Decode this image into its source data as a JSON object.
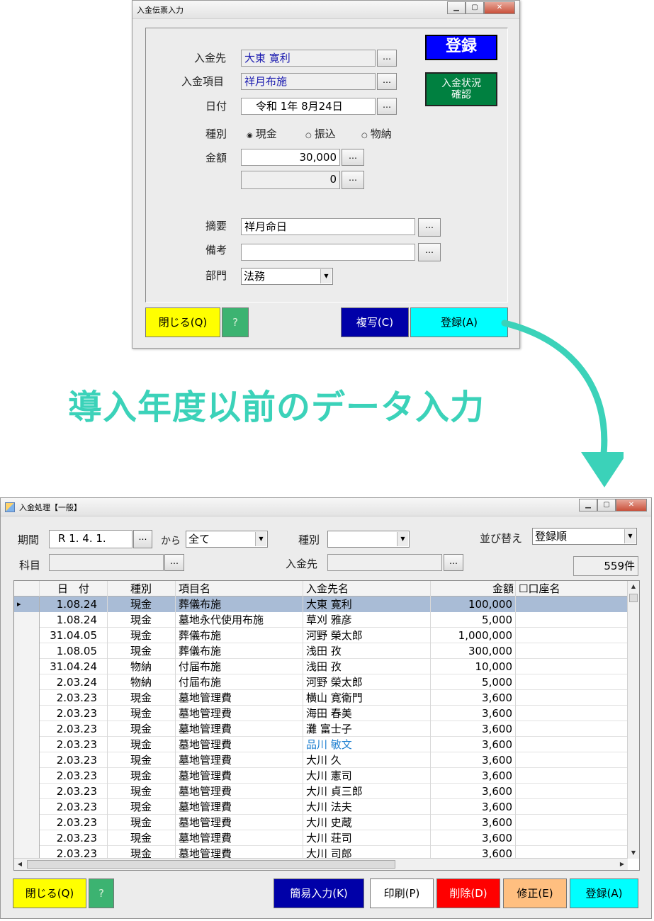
{
  "entry_dialog": {
    "title": "入金伝票入力",
    "register_top_label": "登録",
    "status_button_label": "入金状況\n確認",
    "labels": {
      "payer": "入金先",
      "item": "入金項目",
      "date": "日付",
      "kind": "種別",
      "amount": "金額",
      "summary": "摘要",
      "remarks": "備考",
      "department": "部門"
    },
    "values": {
      "payer": "大東 寛利",
      "item": "祥月布施",
      "date": "令和 1年 8月24日",
      "amount": "30,000",
      "amount2": "0",
      "summary": "祥月命日",
      "remarks": "",
      "department": "法務"
    },
    "kind_options": [
      "現金",
      "振込",
      "物納"
    ],
    "kind_selected": "現金",
    "dots_label": "…",
    "footer": {
      "close": "閉じる(Q)",
      "help": "?",
      "copy": "複写(C)",
      "register": "登録(A)"
    }
  },
  "banner_text": "導入年度以前のデータ入力",
  "list_window": {
    "title": "入金処理【一般】",
    "filters": {
      "period_label": "期間",
      "period_value": "R 1. 4. 1.",
      "from_label": "から",
      "to_value": "全て",
      "kind_label": "種別",
      "kind_value": "",
      "sort_label": "並び替え",
      "sort_value": "登録順",
      "subject_label": "科目",
      "subject_value": "",
      "payer_label": "入金先",
      "payer_value": "",
      "count": "559件"
    },
    "columns": [
      "日　付",
      "種別",
      "項目名",
      "入金先名",
      "金額",
      "口座名"
    ],
    "rows": [
      {
        "date": "1.08.24",
        "kind": "現金",
        "item": "葬儀布施",
        "payer": "大東 寛利",
        "amount": "100,000",
        "account": ""
      },
      {
        "date": "1.08.24",
        "kind": "現金",
        "item": "墓地永代使用布施",
        "payer": "草刈 雅彦",
        "amount": "5,000",
        "account": ""
      },
      {
        "date": "31.04.05",
        "kind": "現金",
        "item": "葬儀布施",
        "payer": "河野 榮太郎",
        "amount": "1,000,000",
        "account": ""
      },
      {
        "date": "1.08.05",
        "kind": "現金",
        "item": "葬儀布施",
        "payer": "浅田 孜",
        "amount": "300,000",
        "account": ""
      },
      {
        "date": "31.04.24",
        "kind": "物納",
        "item": "付届布施",
        "payer": "浅田 孜",
        "amount": "10,000",
        "account": ""
      },
      {
        "date": "2.03.24",
        "kind": "物納",
        "item": "付届布施",
        "payer": "河野 榮太郎",
        "amount": "5,000",
        "account": ""
      },
      {
        "date": "2.03.23",
        "kind": "現金",
        "item": "墓地管理費",
        "payer": "横山 寛衛門",
        "amount": "3,600",
        "account": ""
      },
      {
        "date": "2.03.23",
        "kind": "現金",
        "item": "墓地管理費",
        "payer": "海田 春美",
        "amount": "3,600",
        "account": ""
      },
      {
        "date": "2.03.23",
        "kind": "現金",
        "item": "墓地管理費",
        "payer": "灘 富士子",
        "amount": "3,600",
        "account": ""
      },
      {
        "date": "2.03.23",
        "kind": "現金",
        "item": "墓地管理費",
        "payer": "品川 敏文",
        "amount": "3,600",
        "account": ""
      },
      {
        "date": "2.03.23",
        "kind": "現金",
        "item": "墓地管理費",
        "payer": "大川 久",
        "amount": "3,600",
        "account": ""
      },
      {
        "date": "2.03.23",
        "kind": "現金",
        "item": "墓地管理費",
        "payer": "大川 憲司",
        "amount": "3,600",
        "account": ""
      },
      {
        "date": "2.03.23",
        "kind": "現金",
        "item": "墓地管理費",
        "payer": "大川 貞三郎",
        "amount": "3,600",
        "account": ""
      },
      {
        "date": "2.03.23",
        "kind": "現金",
        "item": "墓地管理費",
        "payer": "大川 法夫",
        "amount": "3,600",
        "account": ""
      },
      {
        "date": "2.03.23",
        "kind": "現金",
        "item": "墓地管理費",
        "payer": "大川 史蔵",
        "amount": "3,600",
        "account": ""
      },
      {
        "date": "2.03.23",
        "kind": "現金",
        "item": "墓地管理費",
        "payer": "大川 荘司",
        "amount": "3,600",
        "account": ""
      },
      {
        "date": "2.03.23",
        "kind": "現金",
        "item": "墓地管理費",
        "payer": "大川 司郎",
        "amount": "3,600",
        "account": ""
      }
    ],
    "footer": {
      "close": "閉じる(Q)",
      "help": "?",
      "quick": "簡易入力(K)",
      "print": "印刷(P)",
      "delete": "削除(D)",
      "edit": "修正(E)",
      "register": "登録(A)"
    }
  },
  "colors": {
    "register_blue": "#0000ff",
    "status_green": "#008040",
    "yellow": "#ffff00",
    "help_green": "#3cb371",
    "navy": "#0000a8",
    "cyan": "#00ffff",
    "red": "#ff0000",
    "orange": "#ffbf80",
    "banner": "#3bd2b9",
    "selected_row": "#a9bcd6",
    "link_text": "#1e7fd0"
  }
}
